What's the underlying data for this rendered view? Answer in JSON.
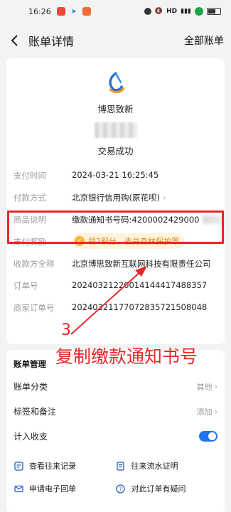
{
  "status_bar": {
    "time": "16:26"
  },
  "header": {
    "title": "账单详情",
    "right_action": "全部账单"
  },
  "merchant": {
    "name": "博思致新",
    "status": "交易成功"
  },
  "details": [
    {
      "label": "支付时间",
      "value": "2024-03-21 16:25:45",
      "chevron": false
    },
    {
      "label": "付款方式",
      "value": "北京银行信用购(原花呗)",
      "chevron": true
    },
    {
      "label": "商品说明",
      "value": "缴款通知书号码:4200002429000",
      "chevron": false
    },
    {
      "label": "支付奖励",
      "value": "领2积分，去兑森林保护罩",
      "chevron": false
    },
    {
      "label": "收款方全称",
      "value": "北京博思致新互联网科技有限责任公司",
      "chevron": false
    },
    {
      "label": "订单号",
      "value": "20240321220014144417488357",
      "chevron": false
    },
    {
      "label": "商家订单号",
      "value": "20240321177072835721508048",
      "chevron": false
    }
  ],
  "management": {
    "title": "账单管理",
    "rows": [
      {
        "label": "账单分类",
        "value": "其他"
      },
      {
        "label": "标签和备注",
        "value": "添加"
      },
      {
        "label": "计入收支",
        "toggle": true
      }
    ],
    "actions": [
      {
        "label": "查看往来记录",
        "icon": "records-icon"
      },
      {
        "label": "往来流水证明",
        "icon": "certificate-icon"
      },
      {
        "label": "申请电子回单",
        "icon": "mail-icon"
      },
      {
        "label": "对此订单有疑问",
        "icon": "question-icon"
      }
    ]
  },
  "annotation": {
    "number": "3",
    "text": "复制缴款通知书号"
  },
  "colors": {
    "accent": "#1f72f2",
    "annotation": "#e8262a",
    "reward": "#d98a12"
  }
}
